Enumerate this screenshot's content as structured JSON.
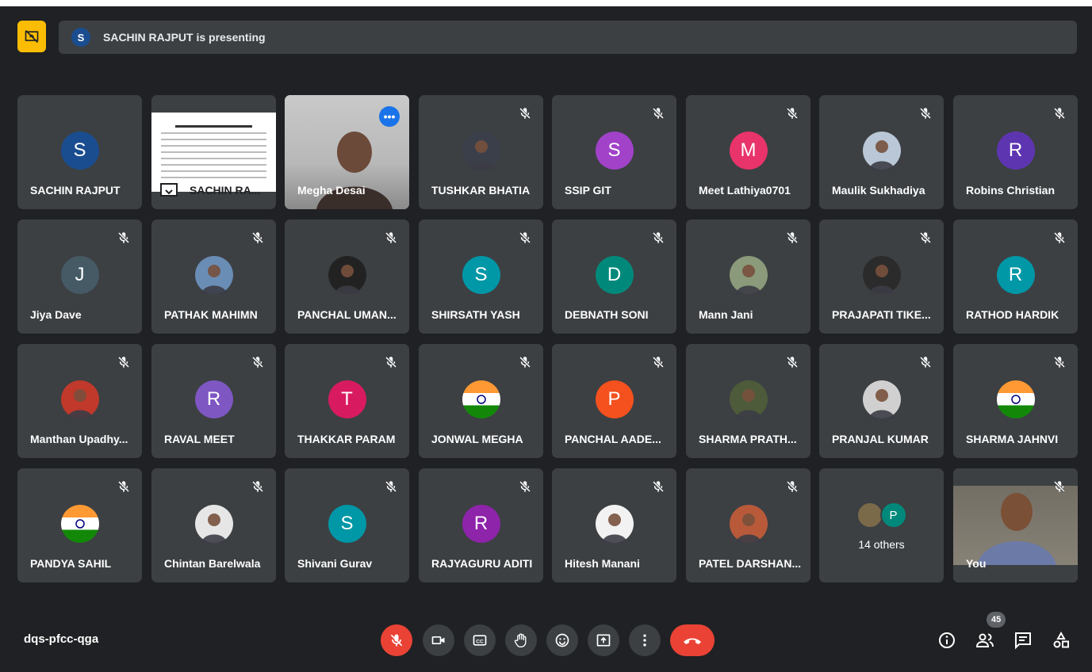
{
  "presenting": {
    "avatar_letter": "S",
    "text": "SACHIN RAJPUT is presenting"
  },
  "tiles": [
    {
      "name": "SACHIN RAJPUT",
      "letter": "S",
      "color": "#1a4d8f",
      "kind": "letter",
      "muted": false
    },
    {
      "name": "SACHIN RA...",
      "kind": "screen",
      "muted": false
    },
    {
      "name": "Megha Desai",
      "kind": "video",
      "muted": false
    },
    {
      "name": "TUSHKAR BHATIA",
      "kind": "photo",
      "photo": "#3a3f4a",
      "muted": true
    },
    {
      "name": "SSIP GIT",
      "letter": "S",
      "color": "#a142c9",
      "kind": "letter",
      "muted": true
    },
    {
      "name": "Meet Lathiya0701",
      "letter": "M",
      "color": "#e8336b",
      "kind": "letter",
      "muted": true
    },
    {
      "name": "Maulik Sukhadiya",
      "kind": "photo",
      "photo": "#b9c7d6",
      "muted": true
    },
    {
      "name": "Robins Christian",
      "letter": "R",
      "color": "#5e35b1",
      "kind": "letter",
      "muted": true
    },
    {
      "name": "Jiya Dave",
      "letter": "J",
      "color": "#455a64",
      "kind": "letter",
      "muted": true
    },
    {
      "name": "PATHAK MAHIMN",
      "kind": "photo",
      "photo": "#6a8db5",
      "muted": true
    },
    {
      "name": "PANCHAL UMAN...",
      "kind": "photo",
      "photo": "#222",
      "muted": true
    },
    {
      "name": "SHIRSATH YASH",
      "letter": "S",
      "color": "#0097a7",
      "kind": "letter",
      "muted": true
    },
    {
      "name": "DEBNATH SONI",
      "letter": "D",
      "color": "#00897b",
      "kind": "letter",
      "muted": true
    },
    {
      "name": "Mann Jani",
      "kind": "photo",
      "photo": "#8a9a7a",
      "muted": true
    },
    {
      "name": "PRAJAPATI TIKE...",
      "kind": "photo",
      "photo": "#2b2b2b",
      "muted": true
    },
    {
      "name": "RATHOD HARDIK",
      "letter": "R",
      "color": "#0097a7",
      "kind": "letter",
      "muted": true
    },
    {
      "name": "Manthan Upadhy...",
      "kind": "photo",
      "photo": "#c0392b",
      "muted": true
    },
    {
      "name": "RAVAL MEET",
      "letter": "R",
      "color": "#7e57c2",
      "kind": "letter",
      "muted": true
    },
    {
      "name": "THAKKAR PARAM",
      "letter": "T",
      "color": "#d81b60",
      "kind": "letter",
      "muted": true
    },
    {
      "name": "JONWAL MEGHA",
      "kind": "flag",
      "muted": true
    },
    {
      "name": "PANCHAL AADE...",
      "letter": "P",
      "color": "#f4511e",
      "kind": "letter",
      "muted": true
    },
    {
      "name": "SHARMA PRATH...",
      "kind": "photo",
      "photo": "#4e5b3a",
      "muted": true
    },
    {
      "name": "PRANJAL KUMAR",
      "kind": "photo",
      "photo": "#d0d0d0",
      "muted": true
    },
    {
      "name": "SHARMA JAHNVI",
      "kind": "flag",
      "muted": true
    },
    {
      "name": "PANDYA SAHIL",
      "kind": "flag",
      "muted": true
    },
    {
      "name": "Chintan Barelwala",
      "kind": "photo",
      "photo": "#e6e6e6",
      "muted": true
    },
    {
      "name": "Shivani Gurav",
      "letter": "S",
      "color": "#0097a7",
      "kind": "letter",
      "muted": true
    },
    {
      "name": "RAJYAGURU ADITI",
      "letter": "R",
      "color": "#8e24aa",
      "kind": "letter",
      "muted": true
    },
    {
      "name": "Hitesh Manani",
      "kind": "photo",
      "photo": "#f2f2f2",
      "muted": true
    },
    {
      "name": "PATEL DARSHAN...",
      "kind": "photo",
      "photo": "#b85a3a",
      "muted": true
    },
    {
      "name": "14 others",
      "kind": "others",
      "others_letter": "P",
      "muted": false
    },
    {
      "name": "You",
      "kind": "self",
      "muted": true
    }
  ],
  "meeting_code": "dqs-pfcc-qga",
  "participants_count": "45",
  "icons": {
    "present_off": "present-to-all-off-icon",
    "mic_off": "mic-off-icon",
    "camera": "videocam-icon",
    "captions": "closed-captions-icon",
    "hand": "raise-hand-icon",
    "emoji": "emoji-reactions-icon",
    "present": "present-now-icon",
    "more": "more-options-icon",
    "end": "end-call-icon",
    "info": "meeting-details-icon",
    "people": "people-icon",
    "chat": "chat-icon",
    "activities": "activities-icon"
  },
  "colors": {
    "background": "#202124",
    "tile": "#3c4043",
    "accent_red": "#ea4335",
    "accent_blue": "#8ab4f8",
    "present_yellow": "#fbbc04"
  }
}
